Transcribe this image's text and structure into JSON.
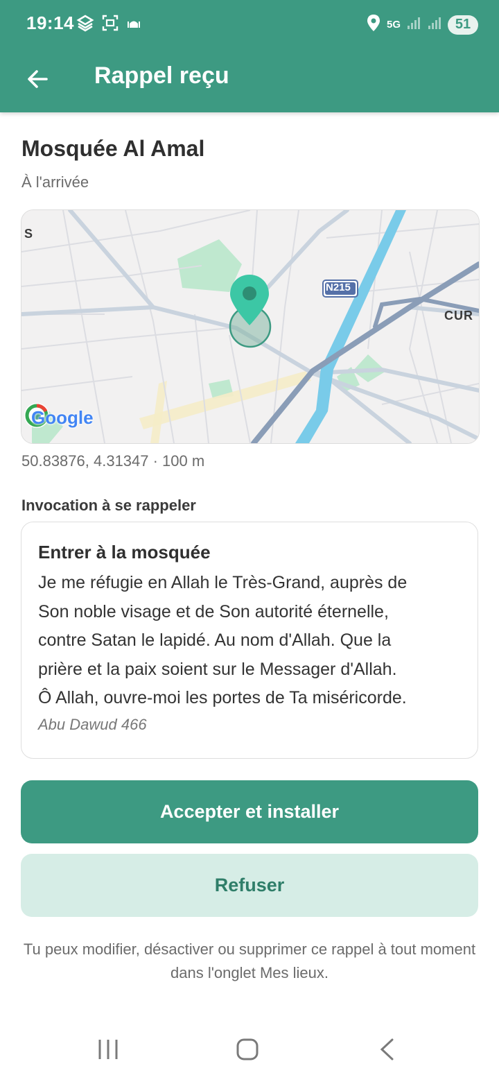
{
  "status_bar": {
    "time": "19:14",
    "battery": "51",
    "network": "5G",
    "icons": [
      "app-icon",
      "screenshot-icon",
      "mosque-icon",
      "location-icon",
      "5g-icon",
      "signal-icon",
      "signal-icon",
      "battery-icon"
    ]
  },
  "app_bar": {
    "title": "Rappel reçu",
    "back_icon": "arrow-left-icon"
  },
  "place": {
    "name": "Mosquée Al Amal",
    "trigger": "À l'arrivée"
  },
  "map": {
    "labels": {
      "left_edge": "S",
      "road": "N215",
      "right_edge": "CUR",
      "logo": "Google"
    }
  },
  "location": {
    "coordinates": "50.83876, 4.31347 · 100 m"
  },
  "invocation": {
    "section_label": "Invocation à se rappeler",
    "title": "Entrer à la mosquée",
    "lines": [
      "Je me réfugie en Allah le Très-Grand, auprès de",
      "Son noble visage et de Son autorité éternelle,",
      "contre Satan le lapidé. Au nom d'Allah. Que la",
      "prière et la paix soient sur le Messager d'Allah.",
      "Ô Allah, ouvre-moi les portes de Ta miséricorde."
    ],
    "source": "Abu Dawud 466"
  },
  "actions": {
    "accept_label": "Accepter et installer",
    "refuse_label": "Refuser"
  },
  "footer": {
    "note": "Tu peux modifier, désactiver ou supprimer ce rappel à tout moment dans l'onglet Mes lieux."
  },
  "colors": {
    "primary": "#3d9a82",
    "secondary_bg": "#d6ede6",
    "secondary_text": "#2f7e69",
    "marker": "#3cc7a5"
  }
}
